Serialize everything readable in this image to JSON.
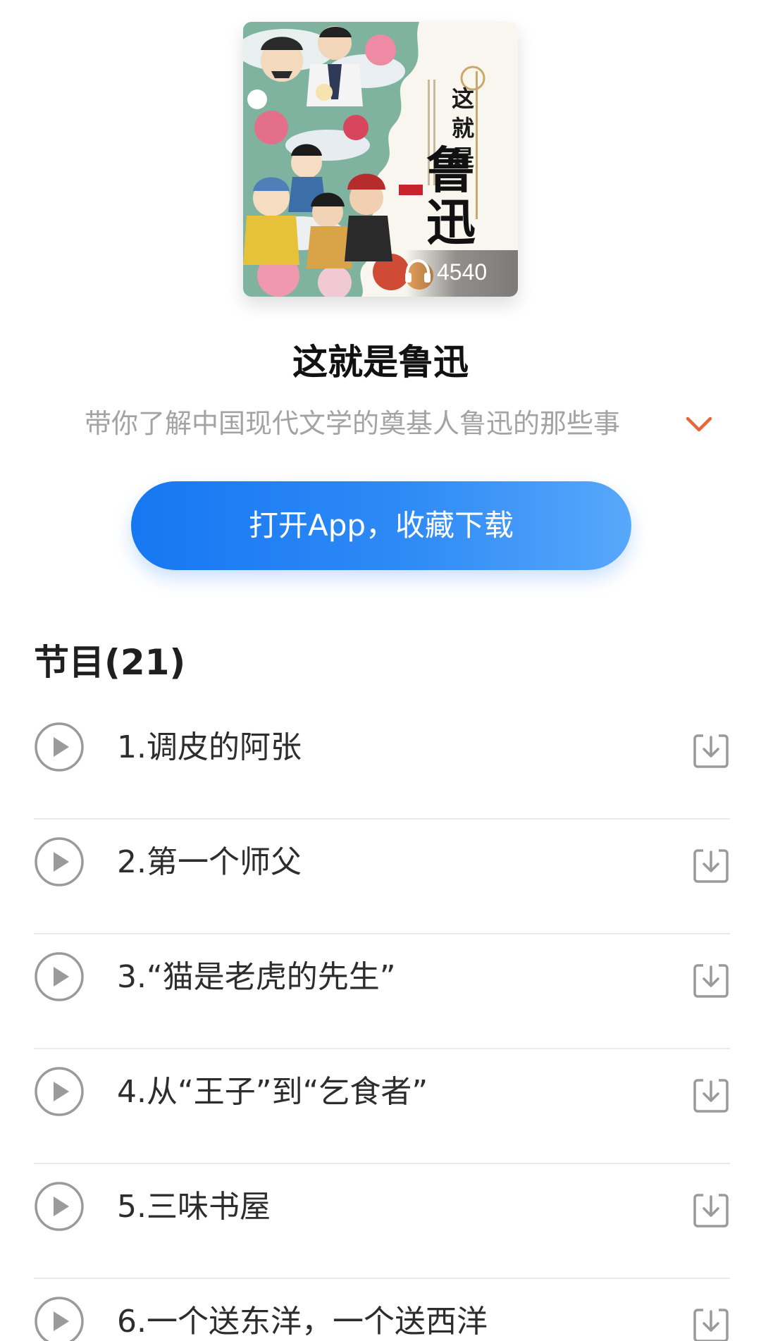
{
  "album": {
    "cover_text": "这就是鲁迅",
    "cover_title_small": "这就是",
    "cover_title_big": "鲁迅",
    "listen_count": "4540",
    "listen_icon": "headphones-icon",
    "title": "这就是鲁迅",
    "subtitle": "带你了解中国现代文学的奠基人鲁迅的那些事",
    "expand_icon": "chevron-down-icon",
    "expand_color": "#e8663d"
  },
  "cta": {
    "label": "打开App，收藏下载",
    "color_start": "#1677f2",
    "color_end": "#58a8fb"
  },
  "episodes": {
    "header": "节目(21)",
    "play_icon": "play-circle-icon",
    "download_icon": "download-icon",
    "items": [
      {
        "title": "1.调皮的阿张"
      },
      {
        "title": "2.第一个师父"
      },
      {
        "title": "3.“猫是老虎的先生”"
      },
      {
        "title": "4.从“王子”到“乞食者”"
      },
      {
        "title": "5.三味书屋"
      },
      {
        "title": "6.一个送东洋，一个送西洋"
      }
    ]
  }
}
